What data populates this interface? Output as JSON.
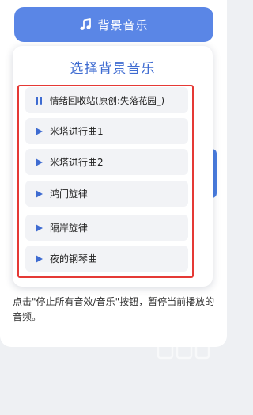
{
  "header": {
    "button_label": "背景音乐",
    "button_icon": "music-note-icon"
  },
  "panel": {
    "title": "选择背景音乐",
    "tracks": [
      {
        "label": "情绪回收站(原创:失落花园_)",
        "state": "playing",
        "icon": "pause-icon"
      },
      {
        "label": "米塔进行曲1",
        "state": "idle",
        "icon": "play-icon"
      },
      {
        "label": "米塔进行曲2",
        "state": "idle",
        "icon": "play-icon"
      },
      {
        "label": "鸿门旋律",
        "state": "idle",
        "icon": "play-icon"
      },
      {
        "label": "隔岸旋律",
        "state": "idle",
        "icon": "play-icon"
      },
      {
        "label": "夜的钢琴曲",
        "state": "idle",
        "icon": "play-icon"
      }
    ]
  },
  "footer": {
    "note": "点击\"停止所有音效/音乐\"按钮，暂停当前播放的音频。"
  },
  "colors": {
    "accent": "#3e6bd1",
    "button_bg": "#5a86e6",
    "highlight_frame": "#e53935",
    "item_bg": "#f2f3f6"
  }
}
